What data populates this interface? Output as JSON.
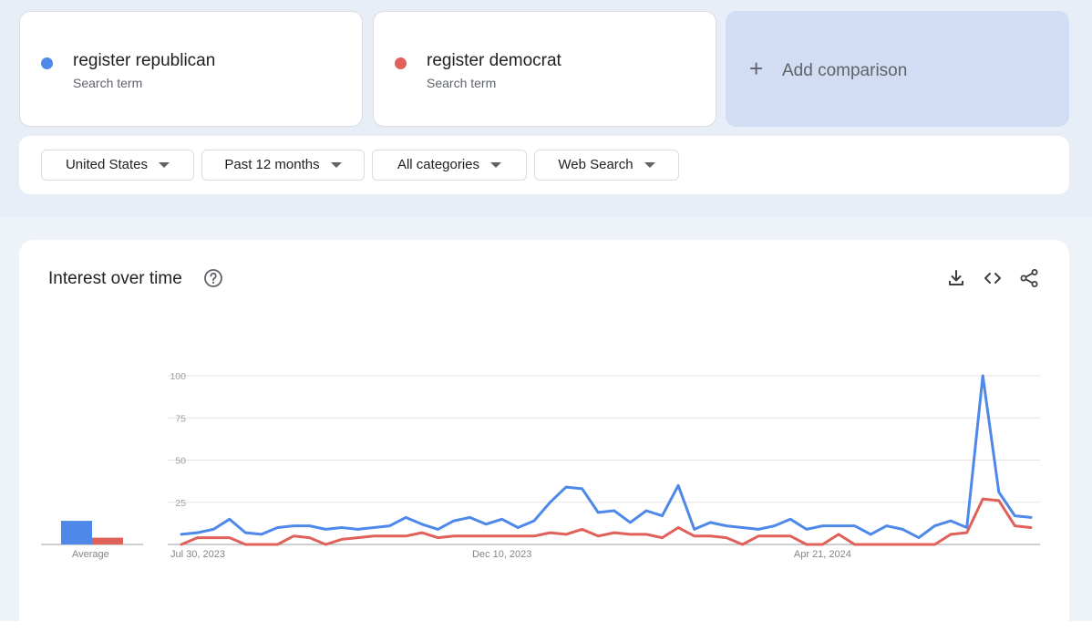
{
  "terms": [
    {
      "name": "register republican",
      "subtitle": "Search term",
      "color": "#4e88e9"
    },
    {
      "name": "register democrat",
      "subtitle": "Search term",
      "color": "#e0605a"
    }
  ],
  "add_comparison": {
    "icon": "plus-icon",
    "label": "Add comparison"
  },
  "filters": [
    {
      "label": "United States"
    },
    {
      "label": "Past 12 months"
    },
    {
      "label": "All categories"
    },
    {
      "label": "Web Search"
    }
  ],
  "panel": {
    "title": "Interest over time",
    "help_icon": "help-circle-icon",
    "tools": [
      "download-icon",
      "embed-code-icon",
      "share-icon"
    ],
    "average_label": "Average"
  },
  "chart_data": {
    "type": "line",
    "ylim": [
      0,
      100
    ],
    "yticks": [
      25,
      50,
      75,
      100
    ],
    "x_tick_labels": [
      "Jul 30, 2023",
      "Dec 10, 2023",
      "Apr 21, 2024"
    ],
    "x_tick_index": [
      0,
      20,
      40
    ],
    "grid": true,
    "series": [
      {
        "name": "register republican",
        "color": "#4e88e9",
        "values": [
          6,
          7,
          9,
          15,
          7,
          6,
          10,
          11,
          11,
          9,
          10,
          9,
          10,
          11,
          16,
          12,
          9,
          14,
          16,
          12,
          15,
          10,
          14,
          25,
          34,
          33,
          19,
          20,
          13,
          20,
          17,
          35,
          9,
          13,
          11,
          10,
          9,
          11,
          15,
          9,
          11,
          11,
          11,
          6,
          11,
          9,
          4,
          11,
          14,
          10,
          100,
          31,
          17,
          16
        ],
        "average": 14
      },
      {
        "name": "register democrat",
        "color": "#e0605a",
        "values": [
          0,
          4,
          4,
          4,
          0,
          0,
          0,
          5,
          4,
          0,
          3,
          4,
          5,
          5,
          5,
          7,
          4,
          5,
          5,
          5,
          5,
          5,
          5,
          7,
          6,
          9,
          5,
          7,
          6,
          6,
          4,
          10,
          5,
          5,
          4,
          0,
          5,
          5,
          5,
          0,
          0,
          6,
          0,
          0,
          0,
          0,
          0,
          0,
          6,
          7,
          27,
          26,
          11,
          10
        ],
        "average": 4
      }
    ]
  }
}
